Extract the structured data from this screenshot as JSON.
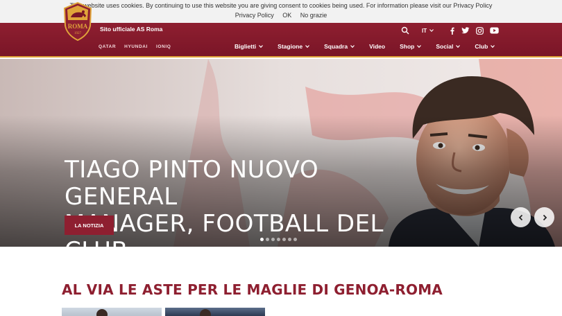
{
  "cookie": {
    "message": "This website uses cookies. By continuing to use this website you are giving consent to cookies being used. For information please visit our Privacy Policy",
    "privacy_label": "Privacy Policy",
    "ok_label": "OK",
    "decline_label": "No grazie"
  },
  "header": {
    "site_title": "Sito ufficiale AS Roma",
    "sponsors": [
      "QATAR",
      "HYUNDAI",
      "IONIQ"
    ],
    "language": "IT",
    "crest_text": "ROMA",
    "crest_year": "1927",
    "social": [
      "facebook-icon",
      "twitter-icon",
      "instagram-icon",
      "youtube-icon"
    ]
  },
  "nav": {
    "items": [
      {
        "label": "Biglietti",
        "dropdown": true
      },
      {
        "label": "Stagione",
        "dropdown": true
      },
      {
        "label": "Squadra",
        "dropdown": true
      },
      {
        "label": "Video",
        "dropdown": false
      },
      {
        "label": "Shop",
        "dropdown": true
      },
      {
        "label": "Social",
        "dropdown": true
      },
      {
        "label": "Club",
        "dropdown": true
      }
    ]
  },
  "hero": {
    "title_line1": "TIAGO PINTO NUOVO GENERAL",
    "title_line2": "MANAGER, FOOTBALL DEL CLUB",
    "button_label": "LA NOTIZIA",
    "slide_count": 7,
    "active_slide": 1
  },
  "section": {
    "title": "AL VIA LE ASTE PER LE MAGLIE DI GENOA-ROMA"
  },
  "colors": {
    "brand": "#8e1f30",
    "accent": "#e0a43a"
  }
}
